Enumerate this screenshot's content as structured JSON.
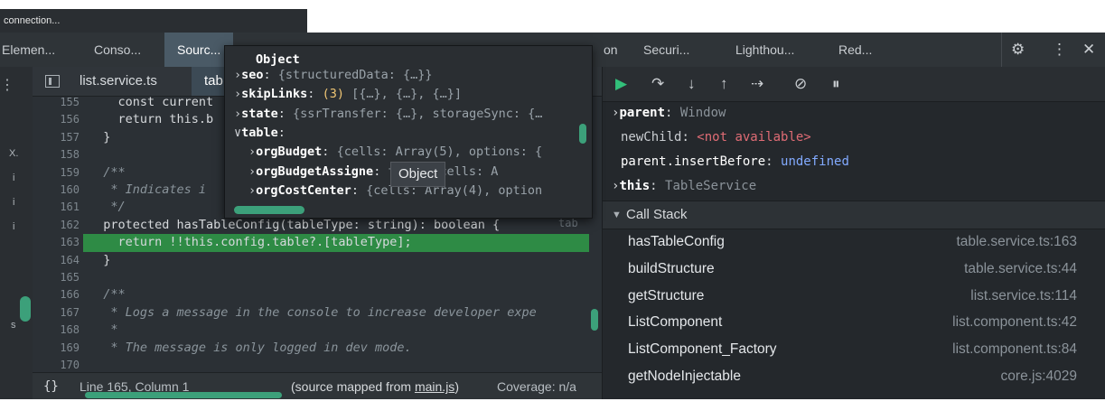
{
  "notification": {
    "text": "connection..."
  },
  "tabs": [
    {
      "label": "Elemen..."
    },
    {
      "label": "Conso..."
    },
    {
      "label": "Sourc..."
    },
    {
      "label": "on"
    },
    {
      "label": "Securi..."
    },
    {
      "label": "Lighthou..."
    },
    {
      "label": "Red..."
    }
  ],
  "toolbar_icons": [
    "gear-icon",
    "kebab-menu-icon",
    "close-icon"
  ],
  "editor": {
    "files": [
      {
        "label": "list.service.ts"
      },
      {
        "label": "tab"
      }
    ],
    "lines": [
      {
        "n": "155",
        "text": "    const current"
      },
      {
        "n": "156",
        "text": "    return this.b"
      },
      {
        "n": "157",
        "text": "  }"
      },
      {
        "n": "158",
        "text": ""
      },
      {
        "n": "159",
        "text": "  /**"
      },
      {
        "n": "160",
        "text": "   * Indicates i"
      },
      {
        "n": "161",
        "text": "   */"
      },
      {
        "n": "162",
        "text": "  protected hasTableConfig(tableType: string): boolean {"
      },
      {
        "n": "163",
        "text": "    return !!this.config.table?.[tableType];"
      },
      {
        "n": "164",
        "text": "  }"
      },
      {
        "n": "165",
        "text": ""
      },
      {
        "n": "166",
        "text": "  /**"
      },
      {
        "n": "167",
        "text": "   * Logs a message in the console to increase developer expe"
      },
      {
        "n": "168",
        "text": "   *"
      },
      {
        "n": "169",
        "text": "   * The message is only logged in dev mode."
      },
      {
        "n": "170",
        "text": ""
      }
    ],
    "inline_hint": "tab",
    "status": {
      "position": "Line 165, Column 1",
      "source_prefix": "(source mapped from ",
      "source_link": "main.js",
      "source_suffix": ")",
      "coverage": "Coverage: n/a"
    }
  },
  "popup": {
    "title": "Object",
    "rows": [
      {
        "key": "seo",
        "value": "{structuredData: {…}}"
      },
      {
        "key": "skipLinks",
        "count": "(3)",
        "value": "[{…}, {…}, {…}]"
      },
      {
        "key": "state",
        "value": "{ssrTransfer: {…}, storageSync: {…"
      },
      {
        "key": "table",
        "value": ""
      },
      {
        "key": "orgBudget",
        "value": "{cells: Array(5), options: {"
      },
      {
        "key": "orgBudgetAssigne",
        "value": "ters: {cells: A"
      },
      {
        "key": "orgCostCenter",
        "value": "{cells: Array(4), option"
      }
    ],
    "hover_hint": "Object"
  },
  "scope": [
    {
      "key": "parent",
      "value": "Window"
    },
    {
      "key": "newChild",
      "value": "<not available>"
    },
    {
      "key": "parent.insertBefore",
      "value": "undefined"
    },
    {
      "key": "this",
      "value": "TableService"
    }
  ],
  "call_stack": {
    "title": "Call Stack",
    "frames": [
      {
        "name": "hasTableConfig",
        "location": "table.service.ts:163"
      },
      {
        "name": "buildStructure",
        "location": "table.service.ts:44"
      },
      {
        "name": "getStructure",
        "location": "list.service.ts:114"
      },
      {
        "name": "ListComponent",
        "location": "list.component.ts:42"
      },
      {
        "name": "ListComponent_Factory",
        "location": "list.component.ts:84"
      },
      {
        "name": "getNodeInjectable",
        "location": "core.js:4029"
      }
    ]
  },
  "left_nav": [
    "X.",
    "i",
    "i",
    "i",
    "s"
  ],
  "colors": {
    "active_tab": "#4a5a66",
    "highlight_line": "#2e8b45",
    "debug_accent": "#32c07a",
    "undefined_value": "#82aaff",
    "not_available": "#e06c75"
  }
}
